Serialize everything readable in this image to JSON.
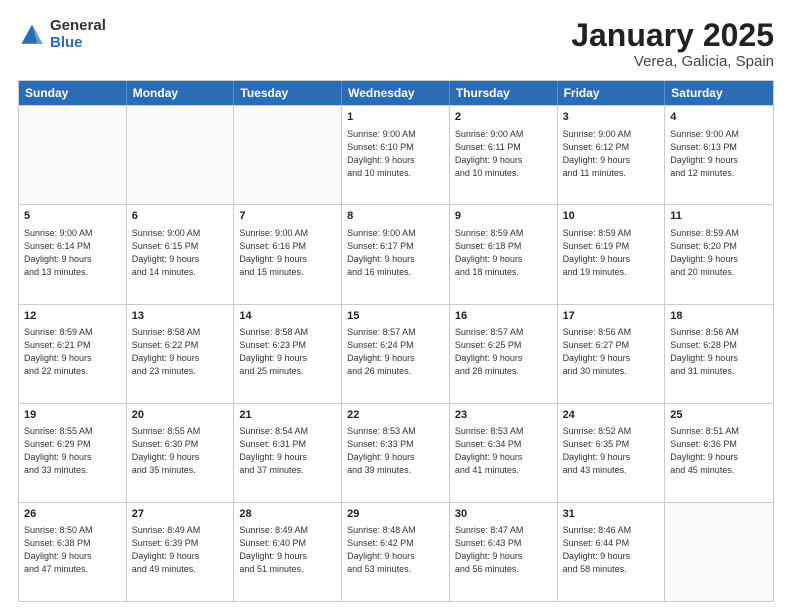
{
  "logo": {
    "general": "General",
    "blue": "Blue"
  },
  "title": {
    "month": "January 2025",
    "location": "Verea, Galicia, Spain"
  },
  "header": {
    "days": [
      "Sunday",
      "Monday",
      "Tuesday",
      "Wednesday",
      "Thursday",
      "Friday",
      "Saturday"
    ]
  },
  "rows": [
    [
      {
        "day": "",
        "text": "",
        "empty": true
      },
      {
        "day": "",
        "text": "",
        "empty": true
      },
      {
        "day": "",
        "text": "",
        "empty": true
      },
      {
        "day": "1",
        "text": "Sunrise: 9:00 AM\nSunset: 6:10 PM\nDaylight: 9 hours\nand 10 minutes.",
        "empty": false
      },
      {
        "day": "2",
        "text": "Sunrise: 9:00 AM\nSunset: 6:11 PM\nDaylight: 9 hours\nand 10 minutes.",
        "empty": false
      },
      {
        "day": "3",
        "text": "Sunrise: 9:00 AM\nSunset: 6:12 PM\nDaylight: 9 hours\nand 11 minutes.",
        "empty": false
      },
      {
        "day": "4",
        "text": "Sunrise: 9:00 AM\nSunset: 6:13 PM\nDaylight: 9 hours\nand 12 minutes.",
        "empty": false
      }
    ],
    [
      {
        "day": "5",
        "text": "Sunrise: 9:00 AM\nSunset: 6:14 PM\nDaylight: 9 hours\nand 13 minutes.",
        "empty": false
      },
      {
        "day": "6",
        "text": "Sunrise: 9:00 AM\nSunset: 6:15 PM\nDaylight: 9 hours\nand 14 minutes.",
        "empty": false
      },
      {
        "day": "7",
        "text": "Sunrise: 9:00 AM\nSunset: 6:16 PM\nDaylight: 9 hours\nand 15 minutes.",
        "empty": false
      },
      {
        "day": "8",
        "text": "Sunrise: 9:00 AM\nSunset: 6:17 PM\nDaylight: 9 hours\nand 16 minutes.",
        "empty": false
      },
      {
        "day": "9",
        "text": "Sunrise: 8:59 AM\nSunset: 6:18 PM\nDaylight: 9 hours\nand 18 minutes.",
        "empty": false
      },
      {
        "day": "10",
        "text": "Sunrise: 8:59 AM\nSunset: 6:19 PM\nDaylight: 9 hours\nand 19 minutes.",
        "empty": false
      },
      {
        "day": "11",
        "text": "Sunrise: 8:59 AM\nSunset: 6:20 PM\nDaylight: 9 hours\nand 20 minutes.",
        "empty": false
      }
    ],
    [
      {
        "day": "12",
        "text": "Sunrise: 8:59 AM\nSunset: 6:21 PM\nDaylight: 9 hours\nand 22 minutes.",
        "empty": false
      },
      {
        "day": "13",
        "text": "Sunrise: 8:58 AM\nSunset: 6:22 PM\nDaylight: 9 hours\nand 23 minutes.",
        "empty": false
      },
      {
        "day": "14",
        "text": "Sunrise: 8:58 AM\nSunset: 6:23 PM\nDaylight: 9 hours\nand 25 minutes.",
        "empty": false
      },
      {
        "day": "15",
        "text": "Sunrise: 8:57 AM\nSunset: 6:24 PM\nDaylight: 9 hours\nand 26 minutes.",
        "empty": false
      },
      {
        "day": "16",
        "text": "Sunrise: 8:57 AM\nSunset: 6:25 PM\nDaylight: 9 hours\nand 28 minutes.",
        "empty": false
      },
      {
        "day": "17",
        "text": "Sunrise: 8:56 AM\nSunset: 6:27 PM\nDaylight: 9 hours\nand 30 minutes.",
        "empty": false
      },
      {
        "day": "18",
        "text": "Sunrise: 8:56 AM\nSunset: 6:28 PM\nDaylight: 9 hours\nand 31 minutes.",
        "empty": false
      }
    ],
    [
      {
        "day": "19",
        "text": "Sunrise: 8:55 AM\nSunset: 6:29 PM\nDaylight: 9 hours\nand 33 minutes.",
        "empty": false
      },
      {
        "day": "20",
        "text": "Sunrise: 8:55 AM\nSunset: 6:30 PM\nDaylight: 9 hours\nand 35 minutes.",
        "empty": false
      },
      {
        "day": "21",
        "text": "Sunrise: 8:54 AM\nSunset: 6:31 PM\nDaylight: 9 hours\nand 37 minutes.",
        "empty": false
      },
      {
        "day": "22",
        "text": "Sunrise: 8:53 AM\nSunset: 6:33 PM\nDaylight: 9 hours\nand 39 minutes.",
        "empty": false
      },
      {
        "day": "23",
        "text": "Sunrise: 8:53 AM\nSunset: 6:34 PM\nDaylight: 9 hours\nand 41 minutes.",
        "empty": false
      },
      {
        "day": "24",
        "text": "Sunrise: 8:52 AM\nSunset: 6:35 PM\nDaylight: 9 hours\nand 43 minutes.",
        "empty": false
      },
      {
        "day": "25",
        "text": "Sunrise: 8:51 AM\nSunset: 6:36 PM\nDaylight: 9 hours\nand 45 minutes.",
        "empty": false
      }
    ],
    [
      {
        "day": "26",
        "text": "Sunrise: 8:50 AM\nSunset: 6:38 PM\nDaylight: 9 hours\nand 47 minutes.",
        "empty": false
      },
      {
        "day": "27",
        "text": "Sunrise: 8:49 AM\nSunset: 6:39 PM\nDaylight: 9 hours\nand 49 minutes.",
        "empty": false
      },
      {
        "day": "28",
        "text": "Sunrise: 8:49 AM\nSunset: 6:40 PM\nDaylight: 9 hours\nand 51 minutes.",
        "empty": false
      },
      {
        "day": "29",
        "text": "Sunrise: 8:48 AM\nSunset: 6:42 PM\nDaylight: 9 hours\nand 53 minutes.",
        "empty": false
      },
      {
        "day": "30",
        "text": "Sunrise: 8:47 AM\nSunset: 6:43 PM\nDaylight: 9 hours\nand 56 minutes.",
        "empty": false
      },
      {
        "day": "31",
        "text": "Sunrise: 8:46 AM\nSunset: 6:44 PM\nDaylight: 9 hours\nand 58 minutes.",
        "empty": false
      },
      {
        "day": "",
        "text": "",
        "empty": true
      }
    ]
  ]
}
